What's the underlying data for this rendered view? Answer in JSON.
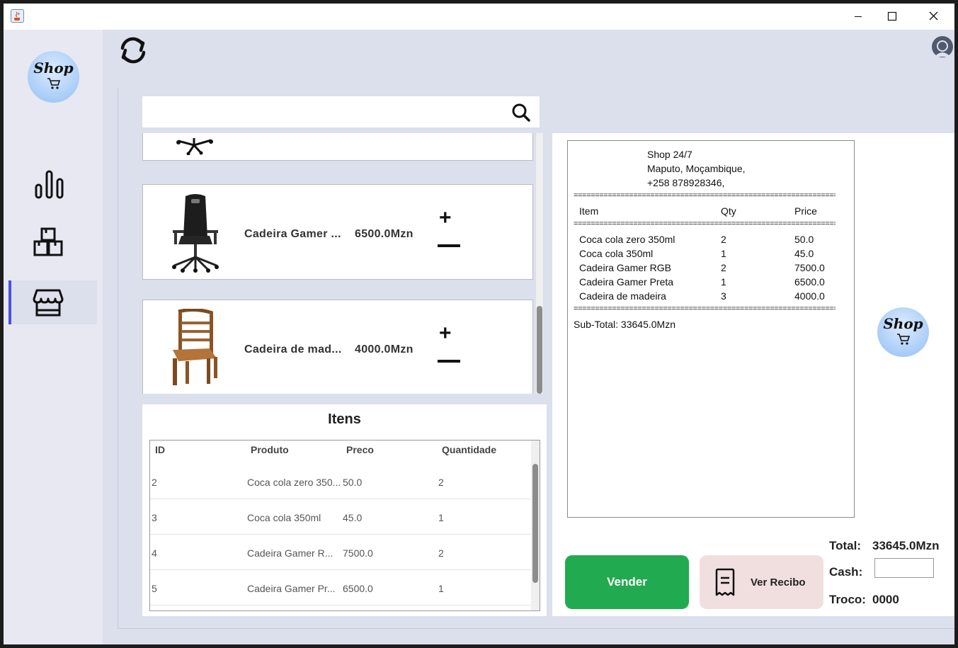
{
  "colors": {
    "accent": "#4b4fe0",
    "sell": "#22aa51",
    "receipt_btn": "#f1dfe0",
    "background": "#dcdfec"
  },
  "titlebar": {
    "icons": [
      "java-icon",
      "minimize-icon",
      "maximize-icon",
      "close-icon"
    ]
  },
  "sidebar": {
    "logo": "Shop",
    "items": [
      {
        "icon": "bar-chart-icon",
        "active": false
      },
      {
        "icon": "boxes-icon",
        "active": false
      },
      {
        "icon": "store-icon",
        "active": true
      }
    ]
  },
  "header": {
    "refresh_icon": "refresh-icon",
    "user_icon": "user-icon"
  },
  "search": {
    "value": "",
    "placeholder": "",
    "icon": "search-icon"
  },
  "products": [
    {
      "name": "",
      "price": ""
    },
    {
      "name": "Cadeira Gamer ...",
      "price": "6500.0Mzn"
    },
    {
      "name": "Cadeira de mad...",
      "price": "4000.0Mzn"
    }
  ],
  "product_controls": {
    "plus": "+",
    "minus": "−"
  },
  "itens": {
    "title": "Itens",
    "columns": [
      "ID",
      "Produto",
      "Preco",
      "Quantidade"
    ],
    "rows": [
      [
        "2",
        "Coca cola zero 350...",
        "50.0",
        "2"
      ],
      [
        "3",
        "Coca cola 350ml",
        "45.0",
        "1"
      ],
      [
        "4",
        "Cadeira Gamer R...",
        "7500.0",
        "2"
      ],
      [
        "5",
        "Cadeira Gamer Pr...",
        "6500.0",
        "1"
      ]
    ]
  },
  "receipt": {
    "header": [
      "Shop 24/7",
      "Maputo, Moçambique,",
      "+258 878928346,"
    ],
    "separator": "===============================================================",
    "columns": [
      "Item",
      "Qty",
      "Price"
    ],
    "lines": [
      [
        "Coca cola zero 350ml",
        "2",
        "50.0"
      ],
      [
        "Coca cola 350ml",
        "1",
        "45.0"
      ],
      [
        "Cadeira Gamer RGB",
        "2",
        "7500.0"
      ],
      [
        "Cadeira Gamer Preta",
        "1",
        "6500.0"
      ],
      [
        "Cadeira de madeira",
        "3",
        "4000.0"
      ]
    ],
    "subtotal": "Sub-Total: 33645.0Mzn"
  },
  "right_logo": "Shop",
  "actions": {
    "sell_label": "Vender",
    "receipt_label": "Ver Recibo"
  },
  "summary": {
    "total_label": "Total:",
    "total_value": "33645.0Mzn",
    "cash_label": "Cash:",
    "cash_value": "",
    "change_label": "Troco:",
    "change_value": "0000"
  }
}
